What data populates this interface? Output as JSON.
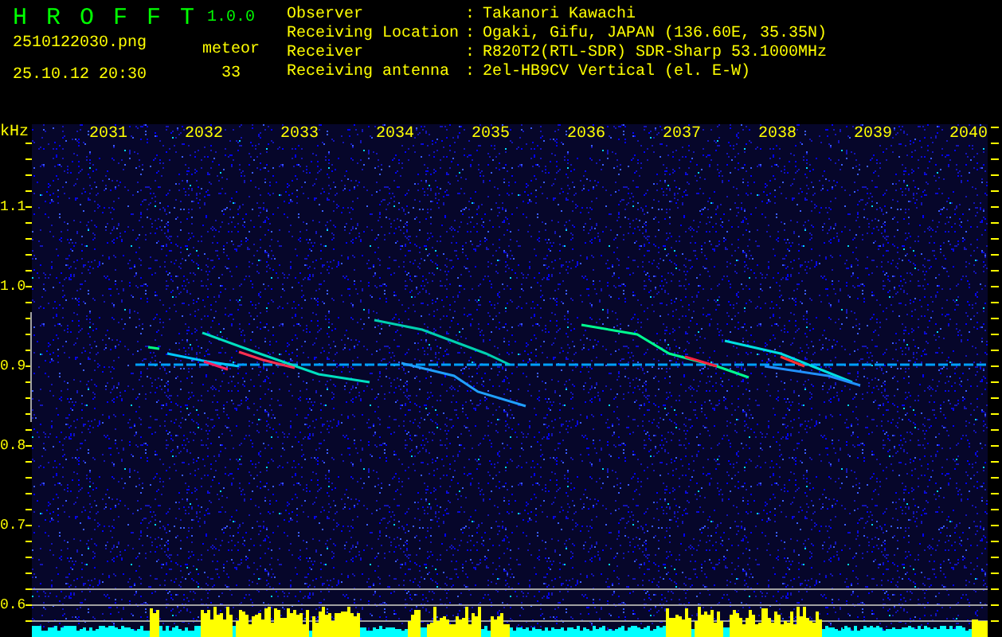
{
  "app": {
    "name": "HROFFT",
    "version": "1.0.0"
  },
  "file": {
    "name": "2510122030.png",
    "datetime": "25.10.12 20:30"
  },
  "count": {
    "label": "meteor",
    "value": "33"
  },
  "info": [
    {
      "label": "Observer",
      "separator": ":",
      "value": "Takanori Kawachi"
    },
    {
      "label": "Receiving Location",
      "separator": ":",
      "value": "Ogaki, Gifu, JAPAN (136.60E, 35.35N)"
    },
    {
      "label": "Receiver",
      "separator": ":",
      "value": "R820T2(RTL-SDR) SDR-Sharp 53.1000MHz"
    },
    {
      "label": "Receiving antenna",
      "separator": ":",
      "value": "2el-HB9CV Vertical (el. E-W)"
    }
  ],
  "spectrogram": {
    "unit": "kHz",
    "time_labels": [
      "2031",
      "2032",
      "2033",
      "2034",
      "2035",
      "2036",
      "2037",
      "2038",
      "2039",
      "2040"
    ],
    "frequency_labels": [
      "1.1",
      "1.0",
      "0.9",
      "0.8",
      "0.7",
      "0.6"
    ]
  }
}
